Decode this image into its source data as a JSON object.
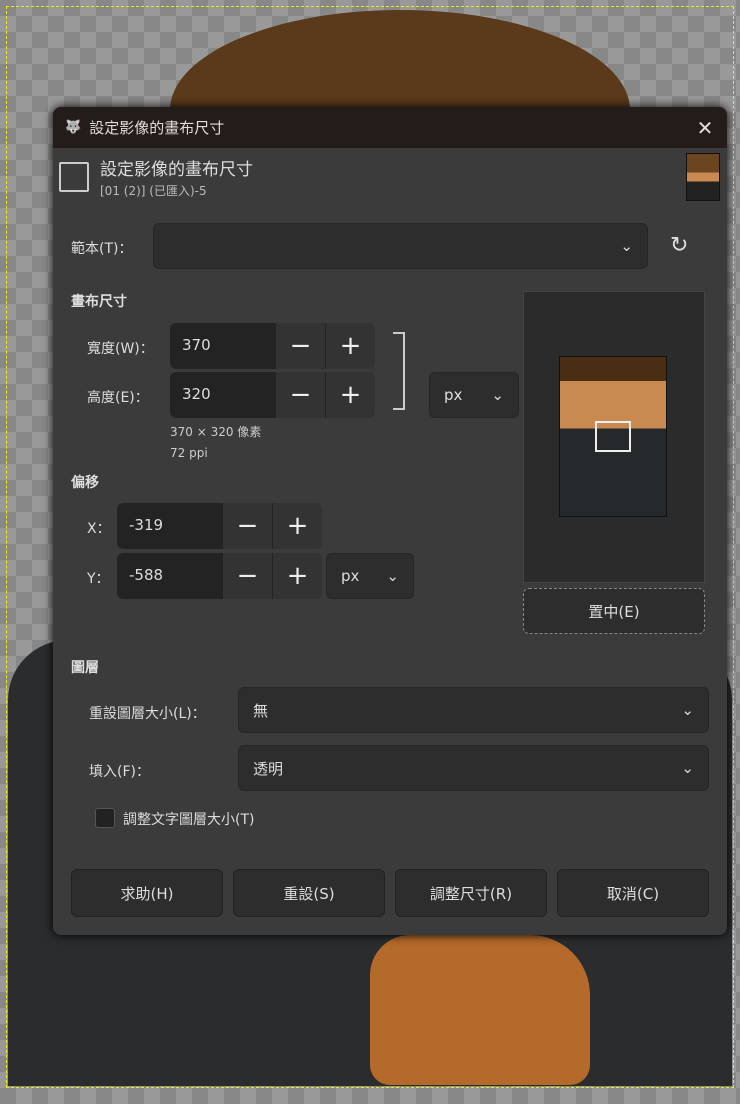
{
  "window": {
    "title": "設定影像的畫布尺寸",
    "close": "✕"
  },
  "header": {
    "title": "設定影像的畫布尺寸",
    "subtitle": "[01 (2)] (已匯入)-5"
  },
  "template": {
    "label": "範本(T)：",
    "value": ""
  },
  "canvas_size": {
    "section": "畫布尺寸",
    "width_label": "寬度(W)：",
    "width": "370",
    "height_label": "高度(E)：",
    "height": "320",
    "unit": "px",
    "info_pixels": "370 × 320 像素",
    "info_ppi": "72 ppi"
  },
  "offset": {
    "section": "偏移",
    "x_label": "X：",
    "x": "-319",
    "y_label": "Y：",
    "y": "-588",
    "unit": "px"
  },
  "center_button": "置中(E)",
  "layers": {
    "section": "圖層",
    "resize_label": "重設圖層大小(L)：",
    "resize_value": "無",
    "fill_label": "填入(F)：",
    "fill_value": "透明",
    "text_resize_label": "調整文字圖層大小(T)",
    "text_resize_checked": false
  },
  "buttons": {
    "help": "求助(H)",
    "reset": "重設(S)",
    "resize": "調整尺寸(R)",
    "cancel": "取消(C)"
  },
  "spin": {
    "minus": "−",
    "plus": "+"
  }
}
